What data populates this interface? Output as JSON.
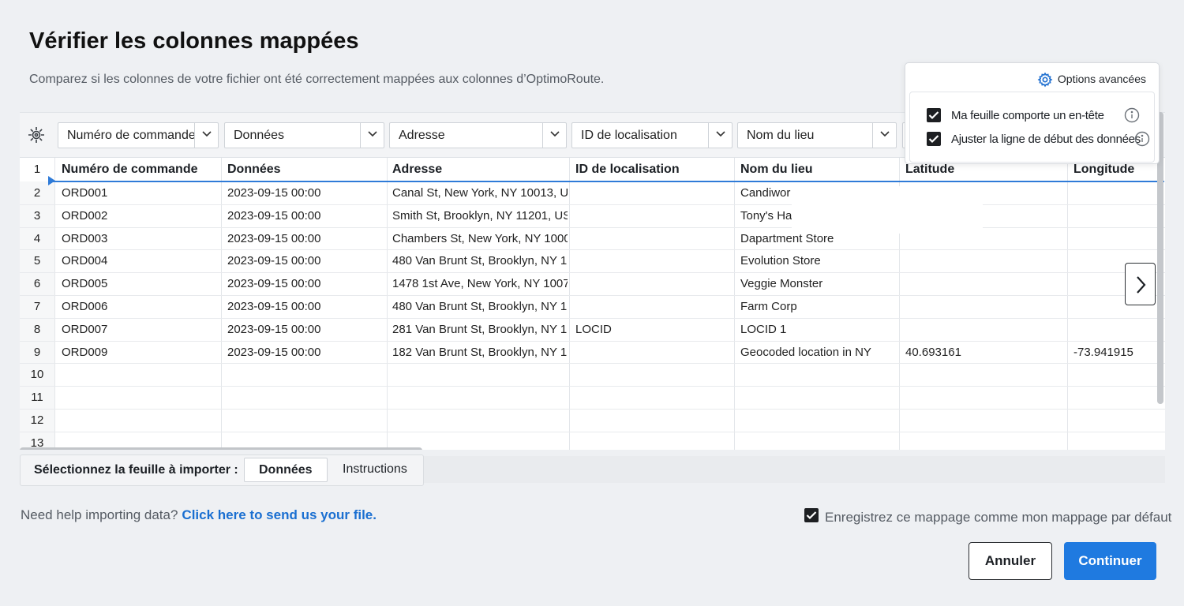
{
  "dialog": {
    "title": "Vérifier les colonnes mappées",
    "subtitle": "Comparez si les colonnes de votre fichier ont été correctement mappées aux colonnes d’OptimoRoute."
  },
  "advanced_options": {
    "label": "Options avancées",
    "options": [
      {
        "label": "Ma feuille comporte un en-tête",
        "checked": true
      },
      {
        "label": "Ajuster la ligne de début des données",
        "checked": true
      }
    ]
  },
  "mapping_dropdowns": [
    "Numéro de commande",
    "Données",
    "Adresse",
    "ID de localisation",
    "Nom du lieu"
  ],
  "table": {
    "header_row_number": "1",
    "headers": [
      "Numéro de commande",
      "Données",
      "Adresse",
      "ID de localisation",
      "Nom du lieu",
      "Latitude",
      "Longitude"
    ],
    "rows": [
      {
        "n": "2",
        "cells": [
          "ORD001",
          "2023-09-15 00:00",
          "Canal St, New York, NY 10013, U",
          "",
          "Candiwor",
          "",
          ""
        ]
      },
      {
        "n": "3",
        "cells": [
          "ORD002",
          "2023-09-15 00:00",
          "Smith St, Brooklyn, NY 11201, US",
          "",
          "Tony's Ha",
          "",
          ""
        ]
      },
      {
        "n": "4",
        "cells": [
          "ORD003",
          "2023-09-15 00:00",
          "Chambers St, New York, NY 1000",
          "",
          "Dapartment Store",
          "",
          ""
        ]
      },
      {
        "n": "5",
        "cells": [
          "ORD004",
          "2023-09-15 00:00",
          "480 Van Brunt St, Brooklyn, NY 1",
          "",
          "Evolution Store",
          "",
          ""
        ]
      },
      {
        "n": "6",
        "cells": [
          "ORD005",
          "2023-09-15 00:00",
          "1478 1st Ave, New York, NY 1007",
          "",
          "Veggie Monster",
          "",
          ""
        ]
      },
      {
        "n": "7",
        "cells": [
          "ORD006",
          "2023-09-15 00:00",
          "480 Van Brunt St, Brooklyn, NY 1",
          "",
          "Farm Corp",
          "",
          ""
        ]
      },
      {
        "n": "8",
        "cells": [
          "ORD007",
          "2023-09-15 00:00",
          "281 Van Brunt St, Brooklyn, NY 1",
          "LOCID",
          "LOCID 1",
          "",
          ""
        ]
      },
      {
        "n": "9",
        "cells": [
          "ORD009",
          "2023-09-15 00:00",
          "182 Van Brunt St, Brooklyn, NY 1",
          "",
          "Geocoded location in NY",
          "40.693161",
          "-73.941915"
        ]
      },
      {
        "n": "10",
        "cells": [
          "",
          "",
          "",
          "",
          "",
          "",
          ""
        ]
      },
      {
        "n": "11",
        "cells": [
          "",
          "",
          "",
          "",
          "",
          "",
          ""
        ]
      },
      {
        "n": "12",
        "cells": [
          "",
          "",
          "",
          "",
          "",
          "",
          ""
        ]
      },
      {
        "n": "13",
        "cells": [
          "",
          "",
          "",
          "",
          "",
          "",
          ""
        ]
      }
    ]
  },
  "sheets": {
    "label": "Sélectionnez la feuille à importer :",
    "tabs": [
      "Données",
      "Instructions"
    ],
    "active": "Données"
  },
  "help": {
    "text": "Need help importing data?",
    "link": "Click here to send us your file."
  },
  "save_default": {
    "label": "Enregistrez ce mappage comme mon mappage par défaut",
    "checked": true
  },
  "buttons": {
    "cancel": "Annuler",
    "continue": "Continuer"
  },
  "icons": {
    "settings": "gear-icon",
    "grid_settings": "grid-gear-icon",
    "info": "info-icon",
    "next": "chevron-right-icon"
  },
  "colors": {
    "accent": "#1f7ae0",
    "link": "#1a6fd1",
    "mapping_line": "#2f7bd8"
  }
}
